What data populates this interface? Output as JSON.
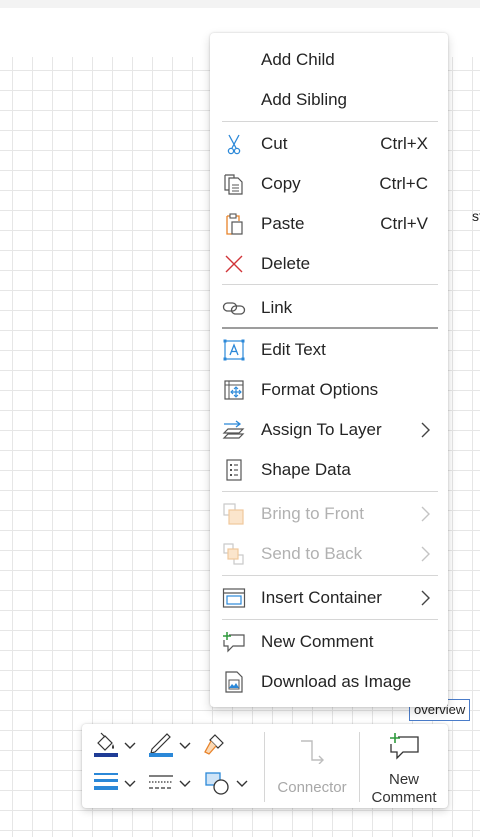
{
  "menu": {
    "add_child": "Add Child",
    "add_sibling": "Add Sibling",
    "cut": "Cut",
    "cut_shortcut": "Ctrl+X",
    "copy": "Copy",
    "copy_shortcut": "Ctrl+C",
    "paste": "Paste",
    "paste_shortcut": "Ctrl+V",
    "delete": "Delete",
    "link": "Link",
    "edit_text": "Edit Text",
    "format_options": "Format Options",
    "assign_to_layer": "Assign To Layer",
    "shape_data": "Shape Data",
    "bring_to_front": "Bring to Front",
    "send_to_back": "Send to Back",
    "insert_container": "Insert Container",
    "new_comment": "New Comment",
    "download_as_image": "Download as Image"
  },
  "toolbar": {
    "connector": "Connector",
    "new_comment_line1": "New",
    "new_comment_line2": "Comment"
  },
  "canvas": {
    "overview_label": "overview",
    "clipped_text": "st"
  },
  "colors": {
    "accent_blue": "#2b88d8",
    "delete_red": "#d13438",
    "paste_orange": "#e8832a",
    "comment_green": "#2e9a3c"
  }
}
